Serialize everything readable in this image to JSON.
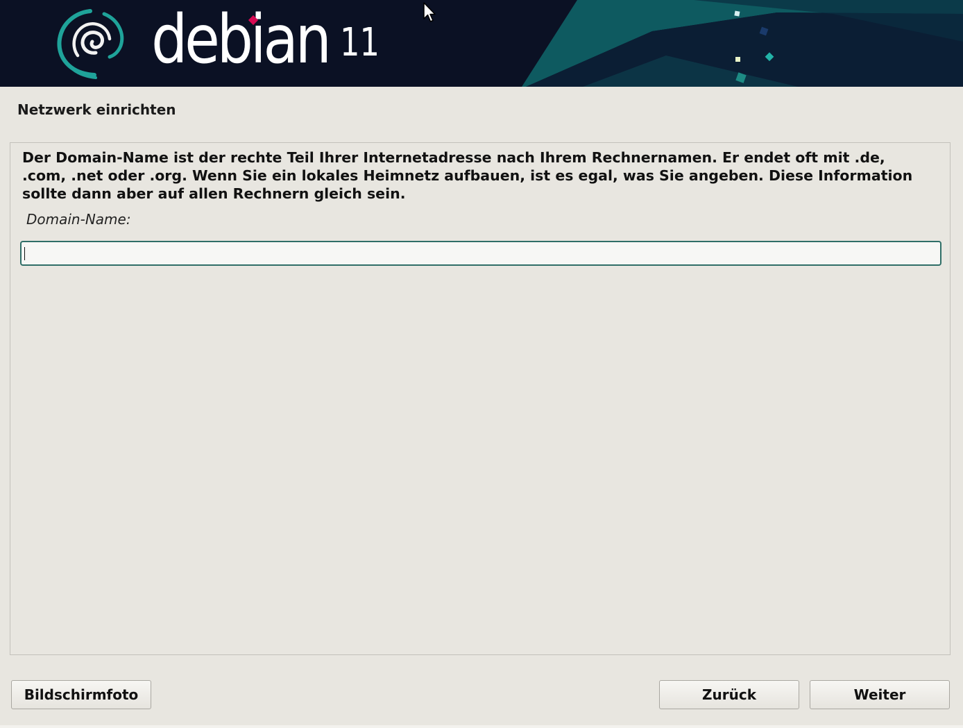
{
  "banner": {
    "brand": "debian",
    "version": "11"
  },
  "step": {
    "title": "Netzwerk einrichten"
  },
  "main": {
    "description": "Der Domain-Name ist der rechte Teil Ihrer Internetadresse nach Ihrem Rechnernamen. Er endet oft mit .de, .com, .net oder .org. Wenn Sie ein lokales Heimnetz aufbauen, ist es egal, was Sie angeben. Diese Information sollte dann aber auf allen Rechnern gleich sein.",
    "field_label": "Domain-Name:",
    "field_value": ""
  },
  "buttons": {
    "screenshot": "Bildschirmfoto",
    "back": "Zurück",
    "next": "Weiter"
  },
  "colors": {
    "banner_bg": "#0b1124",
    "accent": "#1fa39a",
    "logo_dot": "#d70a53",
    "background": "#e8e6e0",
    "input_border": "#2f6e67"
  },
  "icons": {
    "logo": "debian-swirl-icon",
    "pointer": "mouse-pointer-icon"
  }
}
